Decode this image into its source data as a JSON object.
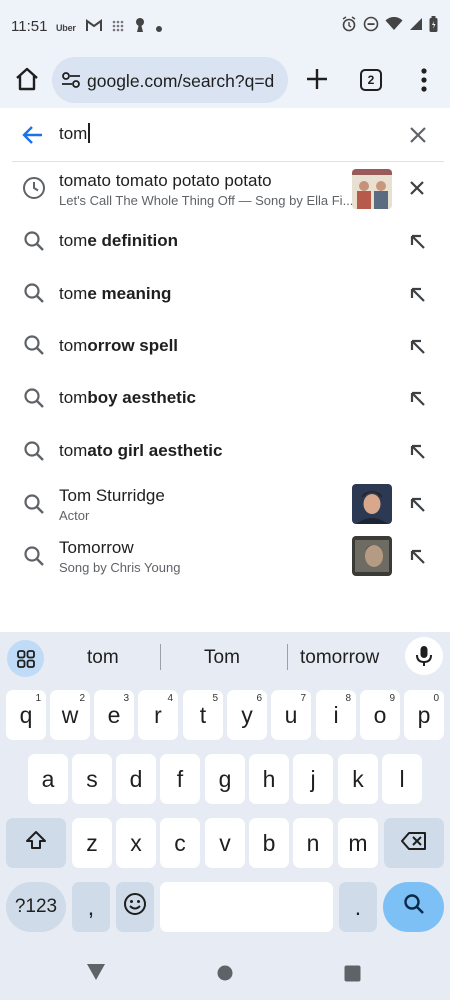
{
  "status_bar": {
    "time": "11:51",
    "left_icons": [
      "uber-icon",
      "gmail-icon",
      "grid-dots-icon",
      "keyhole-icon",
      "dot-icon"
    ],
    "right_icons": [
      "alarm-icon",
      "dnd-icon",
      "wifi-icon",
      "signal-icon",
      "battery-icon"
    ],
    "uber_label": "Uber"
  },
  "toolbar": {
    "url": "google.com/search?q=d",
    "tab_count": "2"
  },
  "search": {
    "query": "tom"
  },
  "suggestions": [
    {
      "type": "history",
      "title": "tomato tomato potato potato",
      "subtitle": "Let's Call The Whole Thing Off — Song by Ella Fi...",
      "action": "remove"
    },
    {
      "type": "search",
      "prefix": "tom",
      "rest": "e definition",
      "action": "fill"
    },
    {
      "type": "search",
      "prefix": "tom",
      "rest": "e meaning",
      "action": "fill"
    },
    {
      "type": "search",
      "prefix": "tom",
      "rest": "orrow spell",
      "action": "fill"
    },
    {
      "type": "search",
      "prefix": "tom",
      "rest": "boy aesthetic",
      "action": "fill"
    },
    {
      "type": "search",
      "prefix": "tom",
      "rest": "ato girl aesthetic",
      "action": "fill"
    },
    {
      "type": "entity",
      "title": "Tom Sturridge",
      "subtitle": "Actor",
      "action": "fill"
    },
    {
      "type": "entity",
      "title": "Tomorrow",
      "subtitle": "Song by Chris Young",
      "action": "fill"
    }
  ],
  "keyboard": {
    "suggestions": [
      "tom",
      "Tom",
      "tomorrow"
    ],
    "row1": [
      {
        "k": "q",
        "h": "1"
      },
      {
        "k": "w",
        "h": "2"
      },
      {
        "k": "e",
        "h": "3"
      },
      {
        "k": "r",
        "h": "4"
      },
      {
        "k": "t",
        "h": "5"
      },
      {
        "k": "y",
        "h": "6"
      },
      {
        "k": "u",
        "h": "7"
      },
      {
        "k": "i",
        "h": "8"
      },
      {
        "k": "o",
        "h": "9"
      },
      {
        "k": "p",
        "h": "0"
      }
    ],
    "row2": [
      "a",
      "s",
      "d",
      "f",
      "g",
      "h",
      "j",
      "k",
      "l"
    ],
    "row3": [
      "z",
      "x",
      "c",
      "v",
      "b",
      "n",
      "m"
    ],
    "symbols_label": "?123",
    "comma": ",",
    "period": "."
  },
  "colors": {
    "accent": "#1a73e8",
    "chrome_bg": "#eef2f9",
    "omnibox_bg": "#d9e3f1",
    "keyboard_bg": "#e7ecf4",
    "enter_key": "#7dc0f5"
  }
}
